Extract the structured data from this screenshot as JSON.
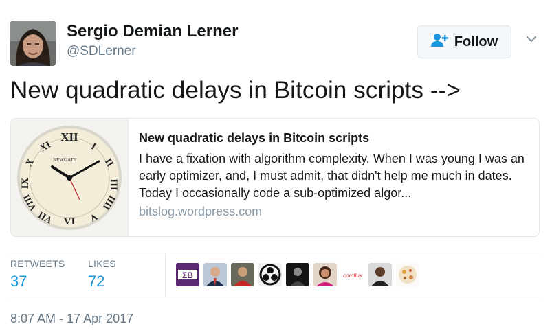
{
  "user": {
    "name": "Sergio Demian Lerner",
    "handle": "@SDLerner"
  },
  "follow_button": {
    "label": "Follow",
    "icon": "follow-user-icon"
  },
  "tweet": {
    "text": "New quadratic delays in Bitcoin scripts -->"
  },
  "card": {
    "title": "New quadratic delays in Bitcoin scripts",
    "description": "I have a fixation with algorithm complexity. When I was young I was an early optimizer, and, I must admit, that didn't help me much in dates. Today I occasionally code a sub-optimized algor...",
    "domain": "bitslog.wordpress.com",
    "clock": {
      "brand": "NEWGATE",
      "numerals": [
        "XII",
        "I",
        "II",
        "III",
        "IIII",
        "V",
        "VI",
        "VII",
        "VIII",
        "IX",
        "X",
        "XI"
      ]
    }
  },
  "stats": {
    "retweets_label": "RETWEETS",
    "retweets_value": "37",
    "likes_label": "LIKES",
    "likes_value": "72"
  },
  "likers": {
    "first_avatar_text": "ΣB",
    "comflux_text": "comflux"
  },
  "timestamp": "8:07 AM - 17 Apr 2017",
  "colors": {
    "link": "#1b95e0",
    "muted": "#657786",
    "border": "#e1e8ed"
  }
}
